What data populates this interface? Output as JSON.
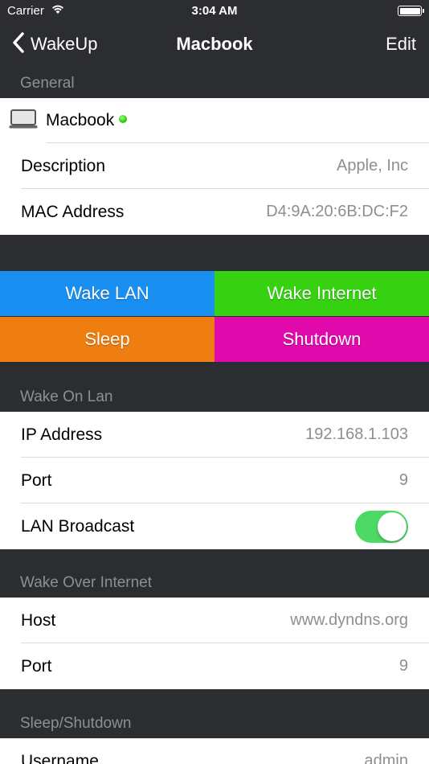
{
  "status_bar": {
    "carrier": "Carrier",
    "time": "3:04 AM"
  },
  "nav": {
    "back_label": "WakeUp",
    "title": "Macbook",
    "edit_label": "Edit"
  },
  "general": {
    "header": "General",
    "device_name": "Macbook",
    "device_online_color": "#22d40a",
    "description_label": "Description",
    "description_value": "Apple, Inc",
    "mac_label": "MAC Address",
    "mac_value": "D4:9A:20:6B:DC:F2"
  },
  "actions": {
    "wake_lan": "Wake LAN",
    "wake_internet": "Wake Internet",
    "sleep": "Sleep",
    "shutdown": "Shutdown",
    "colors": {
      "wake_lan": "#1a8ff2",
      "wake_internet": "#36d212",
      "sleep": "#ef7e10",
      "shutdown": "#e00aac"
    }
  },
  "wake_on_lan": {
    "header": "Wake On Lan",
    "ip_label": "IP Address",
    "ip_value": "192.168.1.103",
    "port_label": "Port",
    "port_value": "9",
    "broadcast_label": "LAN Broadcast",
    "broadcast_on": true
  },
  "wake_over_internet": {
    "header": "Wake Over Internet",
    "host_label": "Host",
    "host_value": "www.dyndns.org",
    "port_label": "Port",
    "port_value": "9"
  },
  "sleep_shutdown": {
    "header": "Sleep/Shutdown",
    "username_label": "Username",
    "username_value": "admin"
  }
}
